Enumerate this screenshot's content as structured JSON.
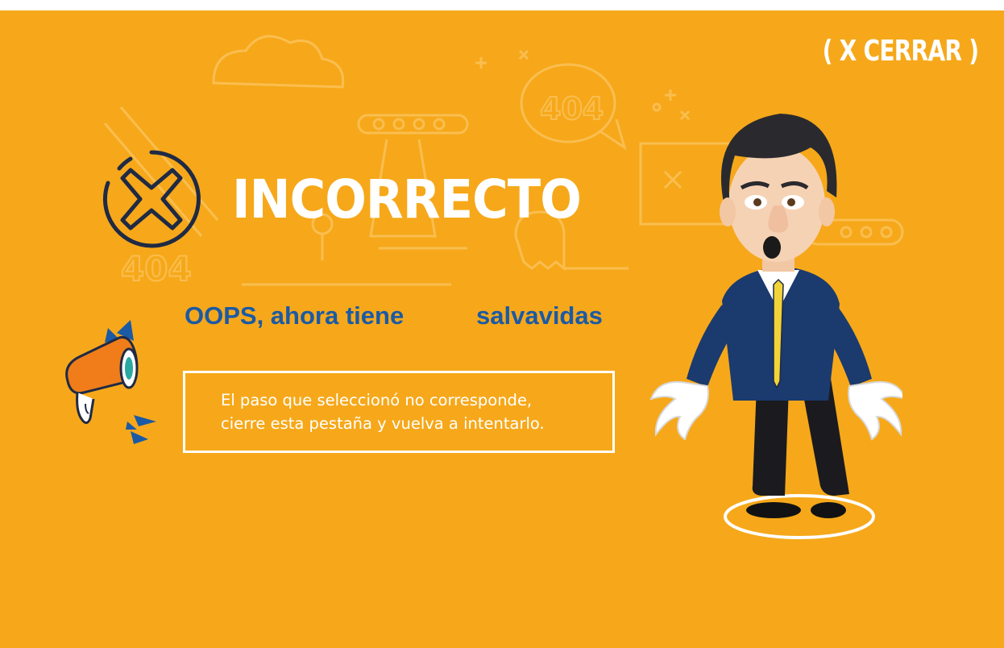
{
  "close": {
    "label": "( X CERRAR )"
  },
  "title": "INCORRECTO",
  "subtitle": {
    "part1": "OOPS, ahora tiene",
    "part2": "salvavidas"
  },
  "message": {
    "line1": "El paso que seleccionó no corresponde,",
    "line2": "cierre esta pestaña y vuelva a intentarlo."
  },
  "background_doodles": {
    "error_codes": [
      "404",
      "404"
    ]
  },
  "colors": {
    "background": "#f6a81a",
    "accent_blue": "#1b5aa5",
    "icon_navy": "#1f2a44",
    "text_white": "#ffffff"
  },
  "icons": [
    "close-x-circle-icon",
    "megaphone-icon",
    "character-illustration"
  ]
}
